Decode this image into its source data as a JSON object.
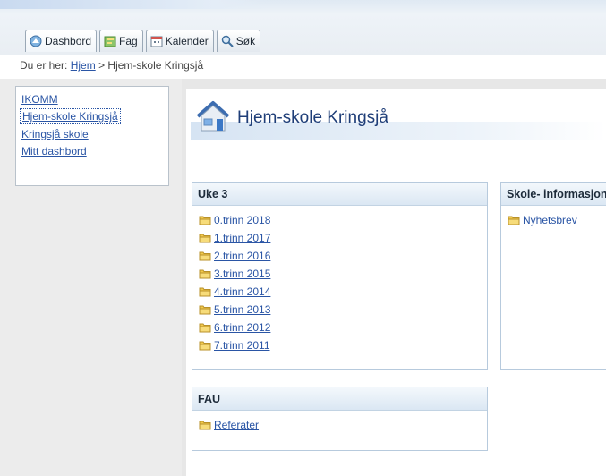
{
  "tabs": [
    {
      "label": "Dashbord",
      "icon": "dashboard-icon"
    },
    {
      "label": "Fag",
      "icon": "subjects-icon"
    },
    {
      "label": "Kalender",
      "icon": "calendar-icon"
    },
    {
      "label": "Søk",
      "icon": "search-icon"
    }
  ],
  "breadcrumb": {
    "prefix": "Du er her:",
    "link": "Hjem",
    "separator": ">",
    "current": "Hjem-skole Kringsjå"
  },
  "sidebar": {
    "items": [
      {
        "label": "IKOMM"
      },
      {
        "label": "Hjem-skole Kringsjå"
      },
      {
        "label": "Kringsjå skole"
      },
      {
        "label": "Mitt dashbord"
      }
    ]
  },
  "page": {
    "title": "Hjem-skole Kringsjå",
    "icon": "house-icon"
  },
  "boxes": {
    "uke": {
      "title": "Uke 3",
      "items": [
        "0.trinn 2018",
        "1.trinn 2017",
        "2.trinn 2016",
        "3.trinn 2015",
        "4.trinn 2014",
        "5.trinn 2013",
        "6.trinn 2012",
        "7.trinn 2011"
      ]
    },
    "fau": {
      "title": "FAU",
      "items": [
        "Referater"
      ]
    },
    "skole": {
      "title": "Skole- informasjon",
      "items": [
        "Nyhetsbrev"
      ]
    }
  },
  "colors": {
    "link": "#2a55a5",
    "title": "#1f3e78",
    "folder": "#f2c94c"
  }
}
